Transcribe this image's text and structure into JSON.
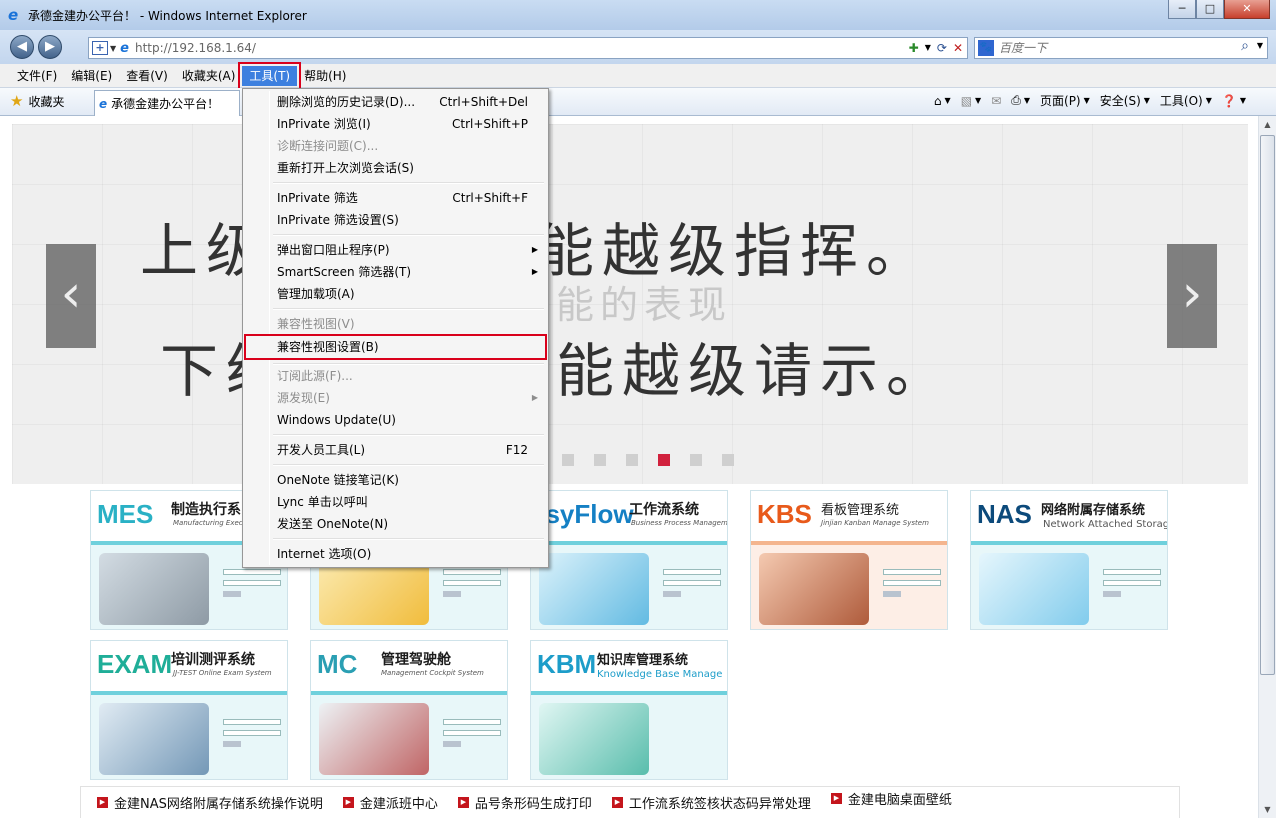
{
  "window": {
    "title": "承德金建办公平台！ - Windows Internet Explorer",
    "min": "─",
    "max": "□",
    "close": "✕"
  },
  "address": {
    "url": "http://192.168.1.64/",
    "back": "◀",
    "forward": "▶"
  },
  "search": {
    "placeholder": "百度一下",
    "logo": "🐾"
  },
  "menubar": {
    "items": [
      "文件(F)",
      "编辑(E)",
      "查看(V)",
      "收藏夹(A)",
      "工具(T)",
      "帮助(H)"
    ]
  },
  "favbar": {
    "favorites_label": "收藏夹",
    "tab_title": "承德金建办公平台！"
  },
  "commandbar": {
    "page": "页面(P)",
    "safety": "安全(S)",
    "tools": "工具(O)"
  },
  "tools_menu": {
    "items": [
      {
        "label": "删除浏览的历史记录(D)...",
        "shortcut": "Ctrl+Shift+Del"
      },
      {
        "label": "InPrivate 浏览(I)",
        "shortcut": "Ctrl+Shift+P"
      },
      {
        "label": "诊断连接问题(C)...",
        "shortcut": ""
      },
      {
        "label": "重新打开上次浏览会话(S)",
        "shortcut": ""
      },
      {
        "label": "InPrivate 筛选",
        "shortcut": "Ctrl+Shift+F"
      },
      {
        "label": "InPrivate 筛选设置(S)",
        "shortcut": ""
      },
      {
        "label": "弹出窗口阻止程序(P)",
        "shortcut": ""
      },
      {
        "label": "SmartScreen 筛选器(T)",
        "shortcut": ""
      },
      {
        "label": "管理加载项(A)",
        "shortcut": ""
      },
      {
        "label": "兼容性视图(V)",
        "shortcut": ""
      },
      {
        "label": "兼容性视图设置(B)",
        "shortcut": ""
      },
      {
        "label": "订阅此源(F)...",
        "shortcut": ""
      },
      {
        "label": "源发现(E)",
        "shortcut": ""
      },
      {
        "label": "Windows Update(U)",
        "shortcut": ""
      },
      {
        "label": "开发人员工具(L)",
        "shortcut": "F12"
      },
      {
        "label": "OneNote 链接笔记(K)",
        "shortcut": ""
      },
      {
        "label": "Lync 单击以呼叫",
        "shortcut": ""
      },
      {
        "label": "发送至 OneNote(N)",
        "shortcut": ""
      },
      {
        "label": "Internet 选项(O)",
        "shortcut": ""
      }
    ]
  },
  "banner": {
    "line1": "上级检查，不能越级指挥。",
    "line2": "下级投诉，不能越级请示。",
    "faint": "无能的表现",
    "prev": "‹",
    "next": "›",
    "active_slide": 4
  },
  "cards": [
    {
      "abbr": "MES",
      "cn": "制造执行系",
      "en": "Manufacturing Exec"
    },
    {
      "abbr": "",
      "cn": "",
      "en": ""
    },
    {
      "abbr": "asyFlow",
      "cn": "工作流系统",
      "en": "Business Process Management"
    },
    {
      "abbr": "KBS",
      "cn": "看板管理系统",
      "en": "Jinjian Kanban Manage System"
    },
    {
      "abbr": "NAS",
      "cn": "网络附属存储系统",
      "en": "Network Attached Storage"
    },
    {
      "abbr": "EXAM",
      "cn": "培训测评系统",
      "en": "JJ-TEST Online Exam System"
    },
    {
      "abbr": "MC",
      "cn": "管理驾驶舱",
      "en": "Management Cockpit System"
    },
    {
      "abbr": "KBM",
      "cn": "知识库管理系统",
      "en": "Knowledge Base Manage"
    }
  ],
  "news": [
    "金建NAS网络附属存储系统操作说明",
    "金建派班中心",
    "品号条形码生成打印",
    "工作流系统签核状态码异常处理",
    "金建电脑桌面壁纸"
  ],
  "colors": {
    "highlight_red": "#d9001b",
    "menu_active": "#3d80df",
    "accent_cyan": "#2ab1c5"
  }
}
